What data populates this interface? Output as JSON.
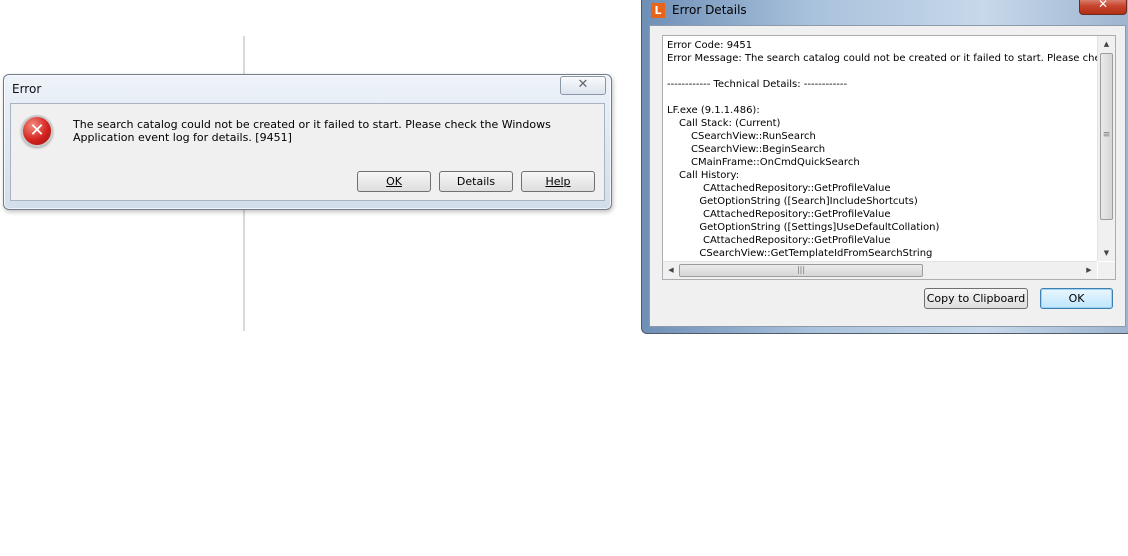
{
  "error_dialog": {
    "title": "Error",
    "message": "The search catalog could not be created or it failed to start. Please check the Windows Application event log for details. [9451]",
    "buttons": {
      "ok": "OK",
      "details": "Details",
      "help": "Help"
    }
  },
  "details_window": {
    "title": "Error Details",
    "app_icon_letter": "L",
    "lines": [
      {
        "indent": 0,
        "text": "Error Code: 9451"
      },
      {
        "indent": 0,
        "text": "Error Message: The search catalog could not be created or it failed to start. Please check"
      },
      {
        "indent": 0,
        "text": ""
      },
      {
        "indent": 0,
        "text": "------------ Technical Details: ------------"
      },
      {
        "indent": 0,
        "text": ""
      },
      {
        "indent": 0,
        "text": "LF.exe (9.1.1.486):"
      },
      {
        "indent": 1,
        "text": "Call Stack: (Current)"
      },
      {
        "indent": 2,
        "text": "CSearchView::RunSearch"
      },
      {
        "indent": 2,
        "text": "CSearchView::BeginSearch"
      },
      {
        "indent": 2,
        "text": "CMainFrame::OnCmdQuickSearch"
      },
      {
        "indent": 1,
        "text": "Call History:"
      },
      {
        "indent": 3,
        "text": "CAttachedRepository::GetProfileValue"
      },
      {
        "indent": 2.7,
        "text": "GetOptionString ([Search]IncludeShortcuts)"
      },
      {
        "indent": 3,
        "text": "CAttachedRepository::GetProfileValue"
      },
      {
        "indent": 2.7,
        "text": "GetOptionString ([Settings]UseDefaultCollation)"
      },
      {
        "indent": 3,
        "text": "CAttachedRepository::GetProfileValue"
      },
      {
        "indent": 2.7,
        "text": "CSearchView::GetTemplateIdFromSearchString"
      }
    ],
    "buttons": {
      "copy": "Copy to Clipboard",
      "ok": "OK"
    }
  }
}
